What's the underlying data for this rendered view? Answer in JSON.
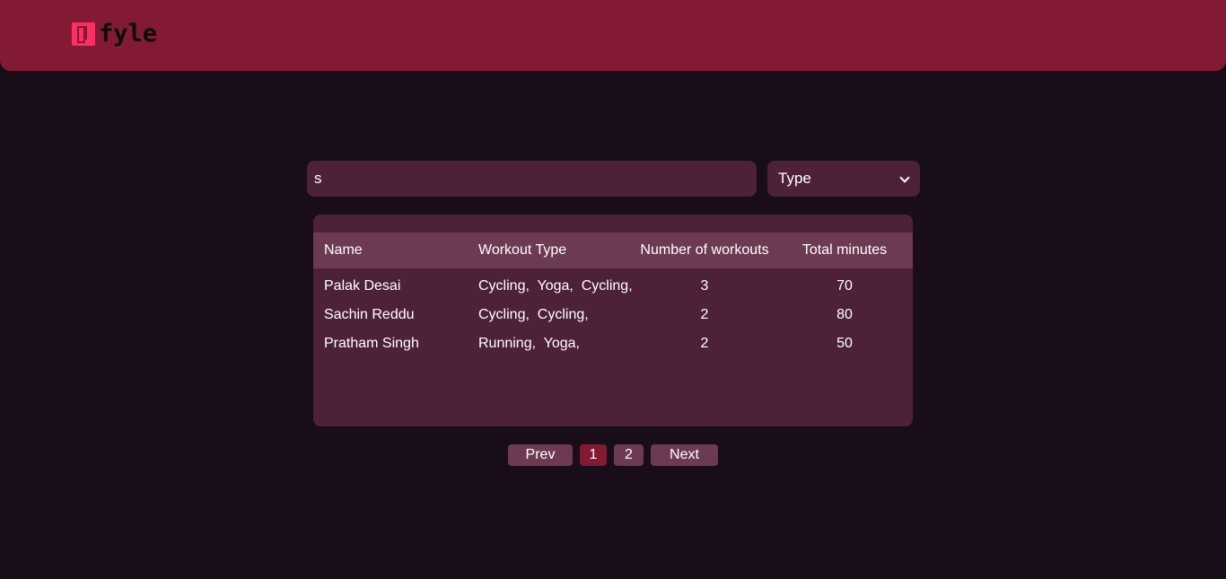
{
  "header": {
    "logo_text": "fyle"
  },
  "search": {
    "value": "s",
    "placeholder": ""
  },
  "filter": {
    "selected": "Type"
  },
  "table": {
    "columns": [
      "Name",
      "Workout Type",
      "Number of workouts",
      "Total minutes"
    ],
    "rows": [
      {
        "name": "Palak Desai",
        "types": "Cycling,  Yoga,  Cycling,",
        "count": "3",
        "minutes": "70"
      },
      {
        "name": "Sachin Reddu",
        "types": "Cycling,  Cycling,",
        "count": "2",
        "minutes": "80"
      },
      {
        "name": "Pratham Singh",
        "types": "Running,  Yoga,",
        "count": "2",
        "minutes": "50"
      }
    ]
  },
  "pagination": {
    "prev_label": "Prev",
    "pages": [
      "1",
      "2"
    ],
    "current_page": "1",
    "next_label": "Next"
  },
  "colors": {
    "background": "#190d1a",
    "header": "#831a33",
    "panel": "#4d2139",
    "table_header": "#6c3a53",
    "logo_accent": "#ff2e63"
  }
}
